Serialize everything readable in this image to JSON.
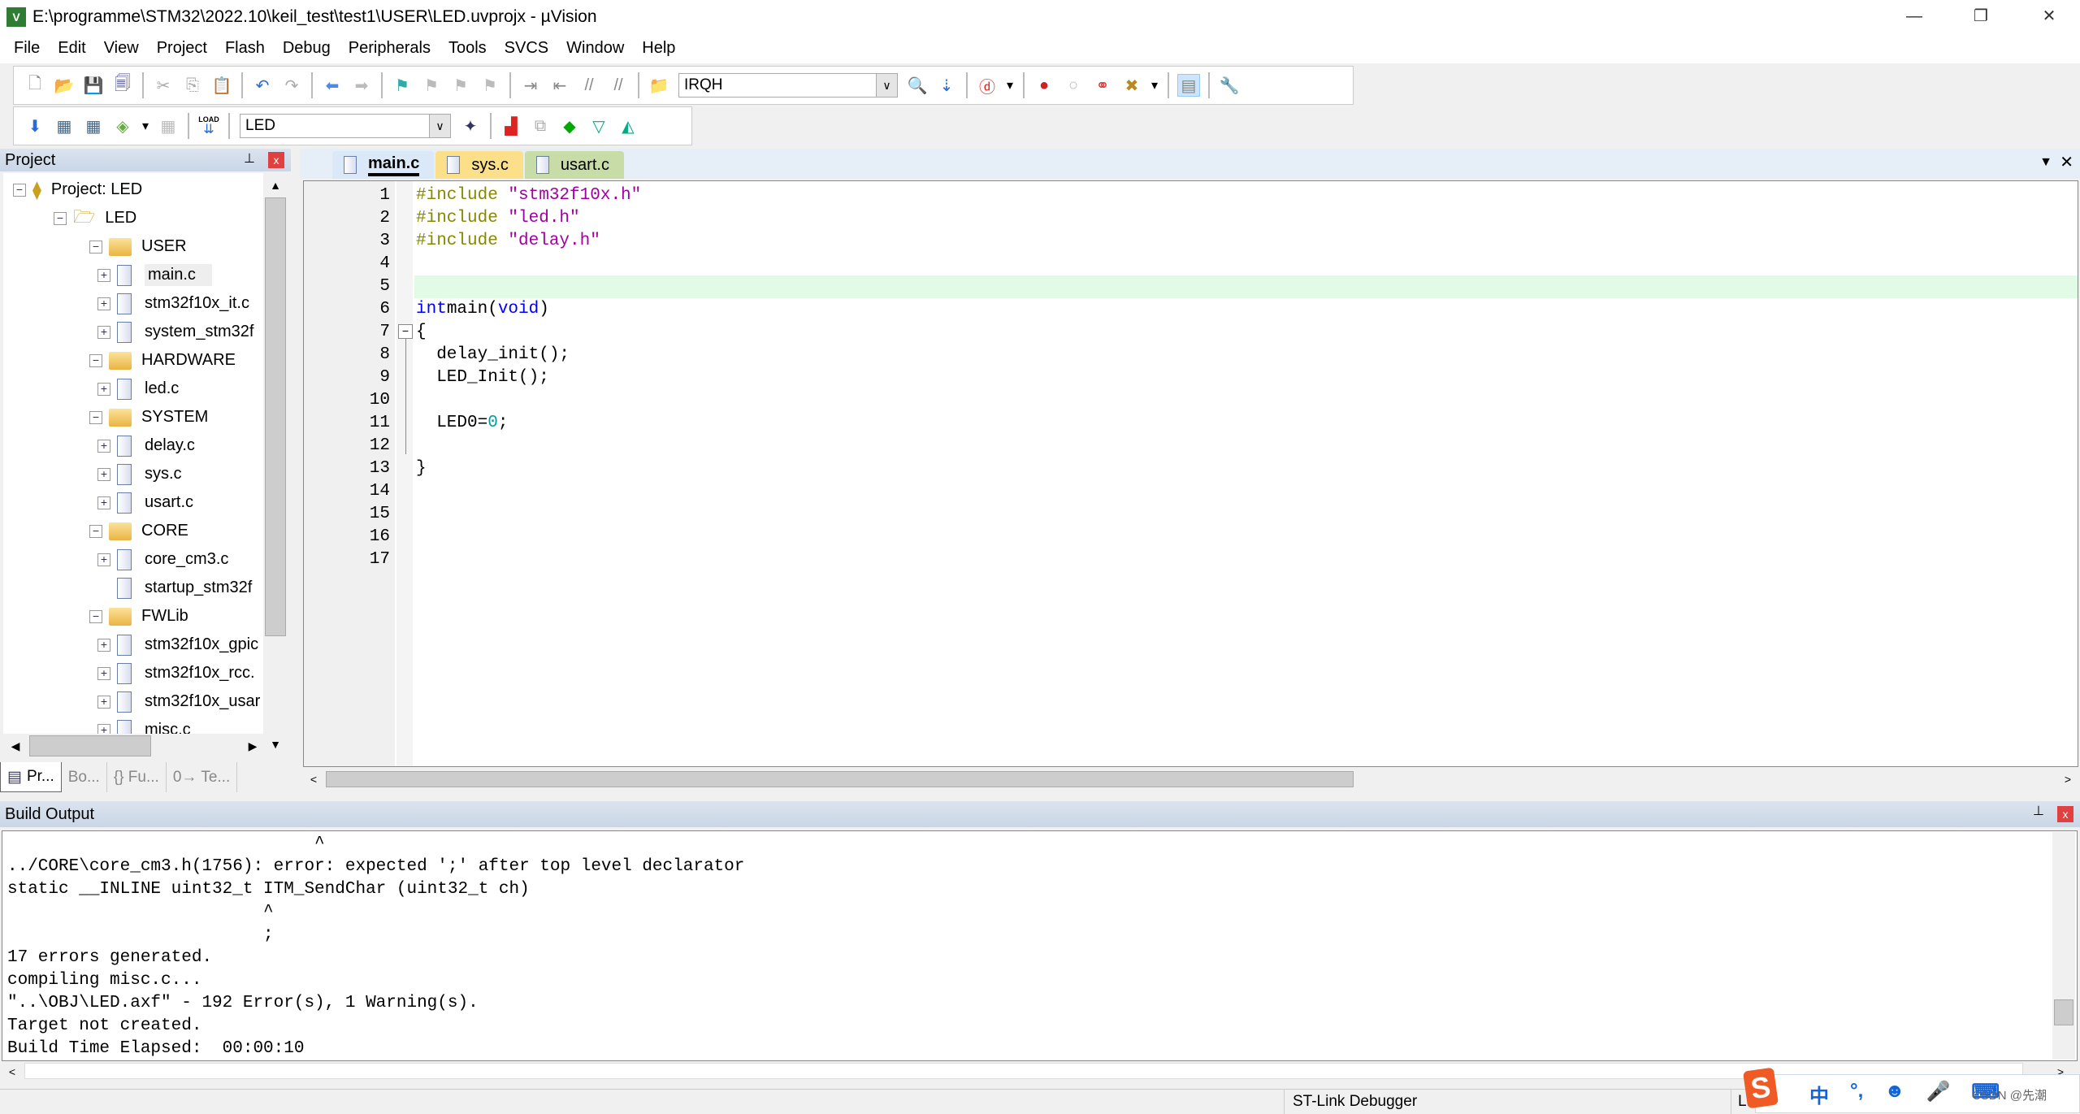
{
  "window": {
    "title": "E:\\programme\\STM32\\2022.10\\keil_test\\test1\\USER\\LED.uvprojx - µVision",
    "app_icon": "uv-logo",
    "min": "—",
    "max": "❐",
    "close": "✕"
  },
  "menu": [
    "File",
    "Edit",
    "View",
    "Project",
    "Flash",
    "Debug",
    "Peripherals",
    "Tools",
    "SVCS",
    "Window",
    "Help"
  ],
  "toolbar1": {
    "find_combo": "IRQH"
  },
  "toolbar2": {
    "target_combo": "LED",
    "load_label": "LOAD"
  },
  "project": {
    "title": "Project",
    "pin": "📌",
    "close": "x",
    "tree": [
      {
        "label": "Project: LED",
        "level": 0,
        "type": "root",
        "exp": "−"
      },
      {
        "label": "LED",
        "level": 1,
        "type": "target",
        "exp": "−"
      },
      {
        "label": "USER",
        "level": 2,
        "type": "folder",
        "exp": "−"
      },
      {
        "label": "main.c",
        "level": 3,
        "type": "file",
        "exp": "+",
        "selected": true
      },
      {
        "label": "stm32f10x_it.c",
        "level": 3,
        "type": "file",
        "exp": "+"
      },
      {
        "label": "system_stm32f",
        "level": 3,
        "type": "file",
        "exp": "+"
      },
      {
        "label": "HARDWARE",
        "level": 2,
        "type": "folder",
        "exp": "−"
      },
      {
        "label": "led.c",
        "level": 3,
        "type": "file",
        "exp": "+"
      },
      {
        "label": "SYSTEM",
        "level": 2,
        "type": "folder",
        "exp": "−"
      },
      {
        "label": "delay.c",
        "level": 3,
        "type": "file",
        "exp": "+"
      },
      {
        "label": "sys.c",
        "level": 3,
        "type": "file",
        "exp": "+"
      },
      {
        "label": "usart.c",
        "level": 3,
        "type": "file",
        "exp": "+"
      },
      {
        "label": "CORE",
        "level": 2,
        "type": "folder",
        "exp": "−"
      },
      {
        "label": "core_cm3.c",
        "level": 3,
        "type": "file",
        "exp": "+"
      },
      {
        "label": "startup_stm32f",
        "level": 3,
        "type": "file",
        "exp": ""
      },
      {
        "label": "FWLib",
        "level": 2,
        "type": "folder",
        "exp": "−"
      },
      {
        "label": "stm32f10x_gpic",
        "level": 3,
        "type": "file",
        "exp": "+"
      },
      {
        "label": "stm32f10x_rcc.",
        "level": 3,
        "type": "file",
        "exp": "+"
      },
      {
        "label": "stm32f10x_usar",
        "level": 3,
        "type": "file",
        "exp": "+"
      },
      {
        "label": "misc.c",
        "level": 3,
        "type": "file",
        "exp": "+"
      }
    ],
    "tabs": [
      {
        "label": "Pr...",
        "icon": "project-icon"
      },
      {
        "label": "Bo...",
        "icon": "books-icon"
      },
      {
        "label": "{} Fu...",
        "icon": "functions-icon"
      },
      {
        "label": "0→ Te...",
        "icon": "templates-icon"
      }
    ]
  },
  "editor": {
    "tabs": [
      {
        "label": "main.c",
        "active": true,
        "color": "#dbe8f8"
      },
      {
        "label": "sys.c",
        "color": "#fce089"
      },
      {
        "label": "usart.c",
        "color": "#c8dca8"
      }
    ],
    "tab_menu": "▼",
    "tab_close": "✕",
    "current_line": 5,
    "lines": [
      [
        [
          "pp",
          "#include "
        ],
        [
          "str",
          "\"stm32f10x.h\""
        ]
      ],
      [
        [
          "pp",
          "#include "
        ],
        [
          "str",
          "\"led.h\""
        ]
      ],
      [
        [
          "pp",
          "#include "
        ],
        [
          "str",
          "\"delay.h\""
        ]
      ],
      [],
      [],
      [
        [
          "kw",
          "int"
        ],
        [
          "",
          "main("
        ],
        [
          "kw",
          "void"
        ],
        [
          "",
          ")"
        ]
      ],
      [
        [
          "",
          "{"
        ]
      ],
      [
        [
          "",
          "  delay_init();"
        ]
      ],
      [
        [
          "",
          "  LED_Init();"
        ]
      ],
      [],
      [
        [
          "",
          "  LED0="
        ],
        [
          "num",
          "0"
        ],
        [
          "",
          ";"
        ]
      ],
      [],
      [
        [
          "",
          "}"
        ]
      ],
      [],
      [],
      [],
      []
    ]
  },
  "build": {
    "title": "Build Output",
    "lines": [
      "                              ^",
      "../CORE\\core_cm3.h(1756): error: expected ';' after top level declarator",
      "static __INLINE uint32_t ITM_SendChar (uint32_t ch)",
      "                         ^",
      "                         ;",
      "17 errors generated.",
      "compiling misc.c...",
      "\"..\\OBJ\\LED.axf\" - 192 Error(s), 1 Warning(s).",
      "Target not created.",
      "Build Time Elapsed:  00:00:10"
    ]
  },
  "status": {
    "debugger": "ST-Link Debugger",
    "position": "L:5"
  },
  "ime": {
    "logo": "S",
    "items": [
      "中",
      "°,",
      "☻",
      "🎤",
      "⌨"
    ],
    "watermark": "CSDN @先潮"
  },
  "colors": {
    "current_line": "#e2fbe6",
    "keyword": "#0000ff",
    "preproc": "#888800",
    "string": "#a000a0",
    "number": "#00a0a0"
  }
}
